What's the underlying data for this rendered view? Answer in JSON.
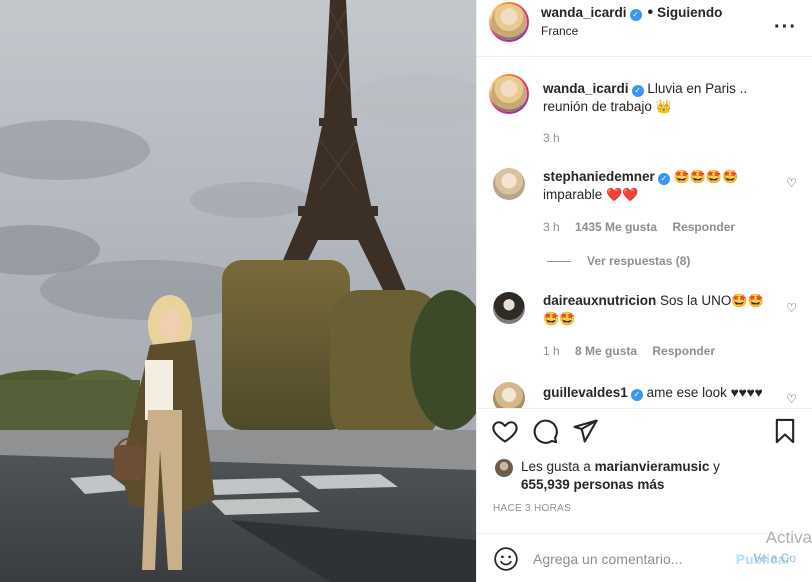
{
  "post": {
    "username": "wanda_icardi",
    "following": "Siguiendo",
    "location": "France",
    "more_icon": "more-options-icon"
  },
  "caption": {
    "username": "wanda_icardi",
    "text_line1": "Lluvia en Paris ..",
    "text_line2": "reunión de trabajo",
    "emoji": "👑",
    "time": "3 h"
  },
  "comments": [
    {
      "username": "stephaniedemner",
      "emoji_text": "🤩🤩🤩🤩",
      "text_line2": "imparable",
      "hearts": "❤️❤️",
      "time": "3 h",
      "likes": "1435 Me gusta",
      "reply": "Responder",
      "view_replies": "Ver respuestas (8)"
    },
    {
      "username": "daireauxnutricion",
      "text": "Sos la UNO",
      "emoji_text": "🤩🤩",
      "emoji_line2": "🤩🤩",
      "time": "1 h",
      "likes": "8 Me gusta",
      "reply": "Responder"
    },
    {
      "username": "guillevaldes1",
      "text": "ame ese look ♥♥♥♥"
    }
  ],
  "likes": {
    "prefix": "Les gusta a",
    "user": "marianvieramusic",
    "connector": "y",
    "count": "655,939 personas más"
  },
  "timestamp": "HACE 3 HORAS",
  "add_comment": {
    "placeholder": "Agrega un comentario...",
    "publish": "Publicar"
  },
  "watermark": {
    "line1": "Activa",
    "line2": "Ve a Co"
  },
  "colors": {
    "verified": "#3897f0",
    "muted": "#8e8e8e",
    "publish_disabled": "#b2dffc",
    "text": "#262626"
  }
}
